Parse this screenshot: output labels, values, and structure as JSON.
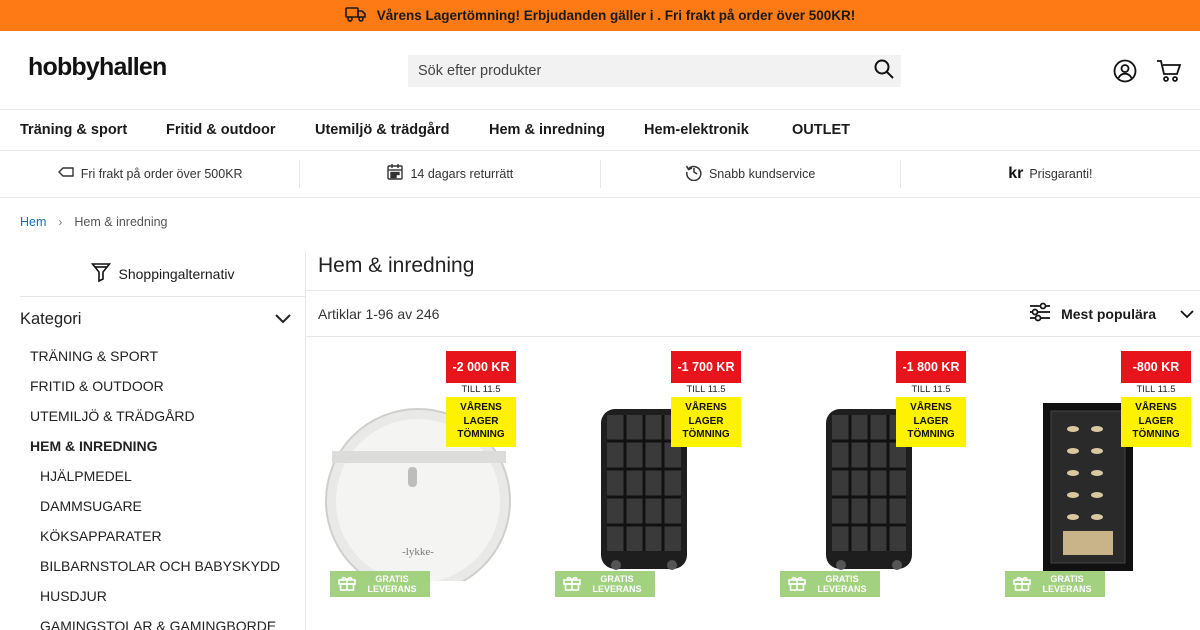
{
  "promo": {
    "text": "Vårens Lagertömning! Erbjudanden gäller i . Fri frakt på order över 500KR!"
  },
  "header": {
    "logo": "hobbyhallen",
    "search_placeholder": "Sök efter produkter"
  },
  "nav": [
    "Träning & sport",
    "Fritid & outdoor",
    "Utemiljö & trädgård",
    "Hem & inredning",
    "Hem-elektronik",
    "OUTLET"
  ],
  "usps": [
    {
      "icon": "tag-icon",
      "text": "Fri frakt på order över 500KR"
    },
    {
      "icon": "calendar-icon",
      "text": "14 dagars returrätt"
    },
    {
      "icon": "history-icon",
      "text": "Snabb kundservice"
    },
    {
      "icon": "kr-icon",
      "glyph": "kr",
      "text": "Prisgaranti!"
    }
  ],
  "breadcrumb": {
    "home": "Hem",
    "current": "Hem & inredning"
  },
  "sidebar": {
    "shopping_options": "Shoppingalternativ",
    "category_heading": "Kategori",
    "categories": [
      {
        "label": "TRÄNING & SPORT",
        "level": "top"
      },
      {
        "label": "FRITID & OUTDOOR",
        "level": "top"
      },
      {
        "label": "UTEMILJÖ & TRÄDGÅRD",
        "level": "top"
      },
      {
        "label": "HEM & INREDNING",
        "level": "top",
        "active": true
      },
      {
        "label": "HJÄLPMEDEL",
        "level": "sub"
      },
      {
        "label": "DAMMSUGARE",
        "level": "sub"
      },
      {
        "label": "KÖKSAPPARATER",
        "level": "sub"
      },
      {
        "label": "BILBARNSTOLAR OCH BABYSKYDD",
        "level": "sub"
      },
      {
        "label": "HUSDJUR",
        "level": "sub"
      },
      {
        "label": "GAMINGSTOLAR & GAMINGBORDE",
        "level": "sub"
      }
    ]
  },
  "main": {
    "title": "Hem & inredning",
    "count": "Artiklar 1-96 av 246",
    "sort": "Mest populära"
  },
  "products": [
    {
      "image": "robot-vacuum",
      "badge": "-2 000 KR",
      "till": "TILL 11.5",
      "promo_lines": [
        "VÅRENS",
        "LAGER",
        "TÖMNING"
      ],
      "gift": [
        "GRATIS",
        "LEVERANS"
      ]
    },
    {
      "image": "sauna-heater",
      "badge": "-1 700 KR",
      "till": "TILL 11.5",
      "promo_lines": [
        "VÅRENS",
        "LAGER",
        "TÖMNING"
      ],
      "gift": [
        "GRATIS",
        "LEVERANS"
      ]
    },
    {
      "image": "sauna-heater",
      "badge": "-1 800 KR",
      "till": "TILL 11.5",
      "promo_lines": [
        "VÅRENS",
        "LAGER",
        "TÖMNING"
      ],
      "gift": [
        "GRATIS",
        "LEVERANS"
      ]
    },
    {
      "image": "wine-cooler",
      "badge": "-800 KR",
      "till": "TILL 11.5",
      "promo_lines": [
        "VÅRENS",
        "LAGER",
        "TÖMNING"
      ],
      "gift": [
        "GRATIS",
        "LEVERANS"
      ]
    }
  ],
  "colors": {
    "promo_bar": "#fd7a14",
    "price_badge": "#e8141b",
    "promo_sticker": "#fff200",
    "gift_badge": "#9ed07a",
    "link": "#1a6fb5"
  }
}
